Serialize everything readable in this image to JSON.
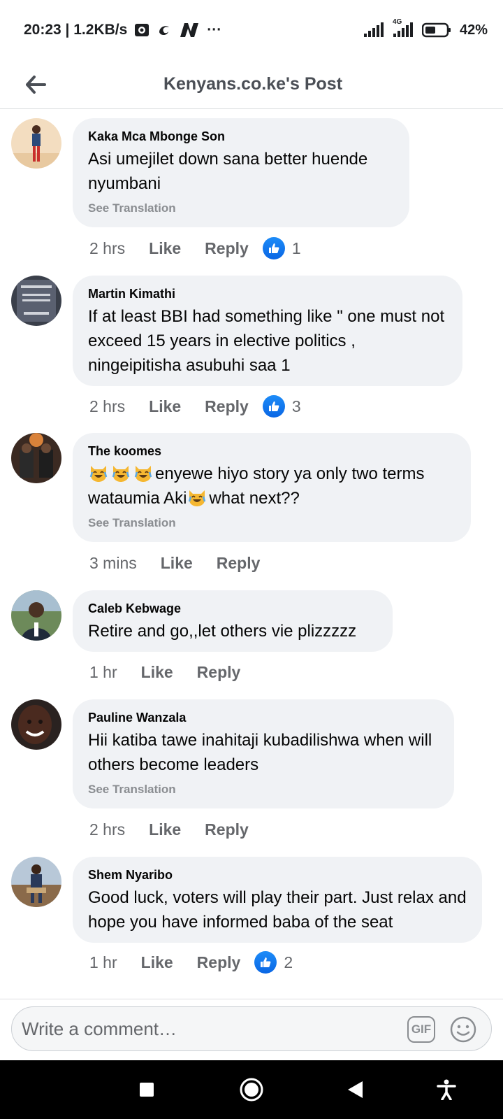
{
  "status_bar": {
    "time_speed": "20:23 | 1.2KB/s",
    "more_dots": "···",
    "network_type": "4G",
    "battery": "42%"
  },
  "header": {
    "title": "Kenyans.co.ke's Post"
  },
  "comments": [
    {
      "author": "Kaka Mca Mbonge Son",
      "text": "Asi umejilet down sana better huende nyumbani",
      "see_translation": "See Translation",
      "time": "2 hrs",
      "like": "Like",
      "reply": "Reply",
      "reactions": "1"
    },
    {
      "author": "Martin Kimathi",
      "text": "If at least BBI had something like \" one must not exceed 15 years in elective politics , ningeipitisha asubuhi saa 1",
      "time": "2 hrs",
      "like": "Like",
      "reply": "Reply",
      "reactions": "3"
    },
    {
      "author": "The koomes",
      "text_part1": "enyewe hiyo story ya only two terms wataumia Aki",
      "text_part2": "what next??",
      "emoji": "laughing-crying-cat",
      "see_translation": "See Translation",
      "time": "3 mins",
      "like": "Like",
      "reply": "Reply"
    },
    {
      "author": "Caleb Kebwage",
      "text": "Retire and go,,let others vie plizzzzz",
      "time": "1 hr",
      "like": "Like",
      "reply": "Reply"
    },
    {
      "author": "Pauline Wanzala",
      "text": "Hii katiba tawe inahitaji kubadilishwa when will others become leaders",
      "see_translation": "See Translation",
      "time": "2 hrs",
      "like": "Like",
      "reply": "Reply"
    },
    {
      "author": "Shem Nyaribo",
      "text": "Good luck, voters will play their part. Just relax and hope you have informed baba of the seat",
      "time": "1 hr",
      "like": "Like",
      "reply": "Reply",
      "reactions": "2"
    }
  ],
  "composer": {
    "placeholder": "Write a comment…",
    "gif_label": "GIF"
  },
  "colors": {
    "like_blue": "#1877f2",
    "bubble": "#f0f2f5",
    "meta_text": "#65676b"
  }
}
